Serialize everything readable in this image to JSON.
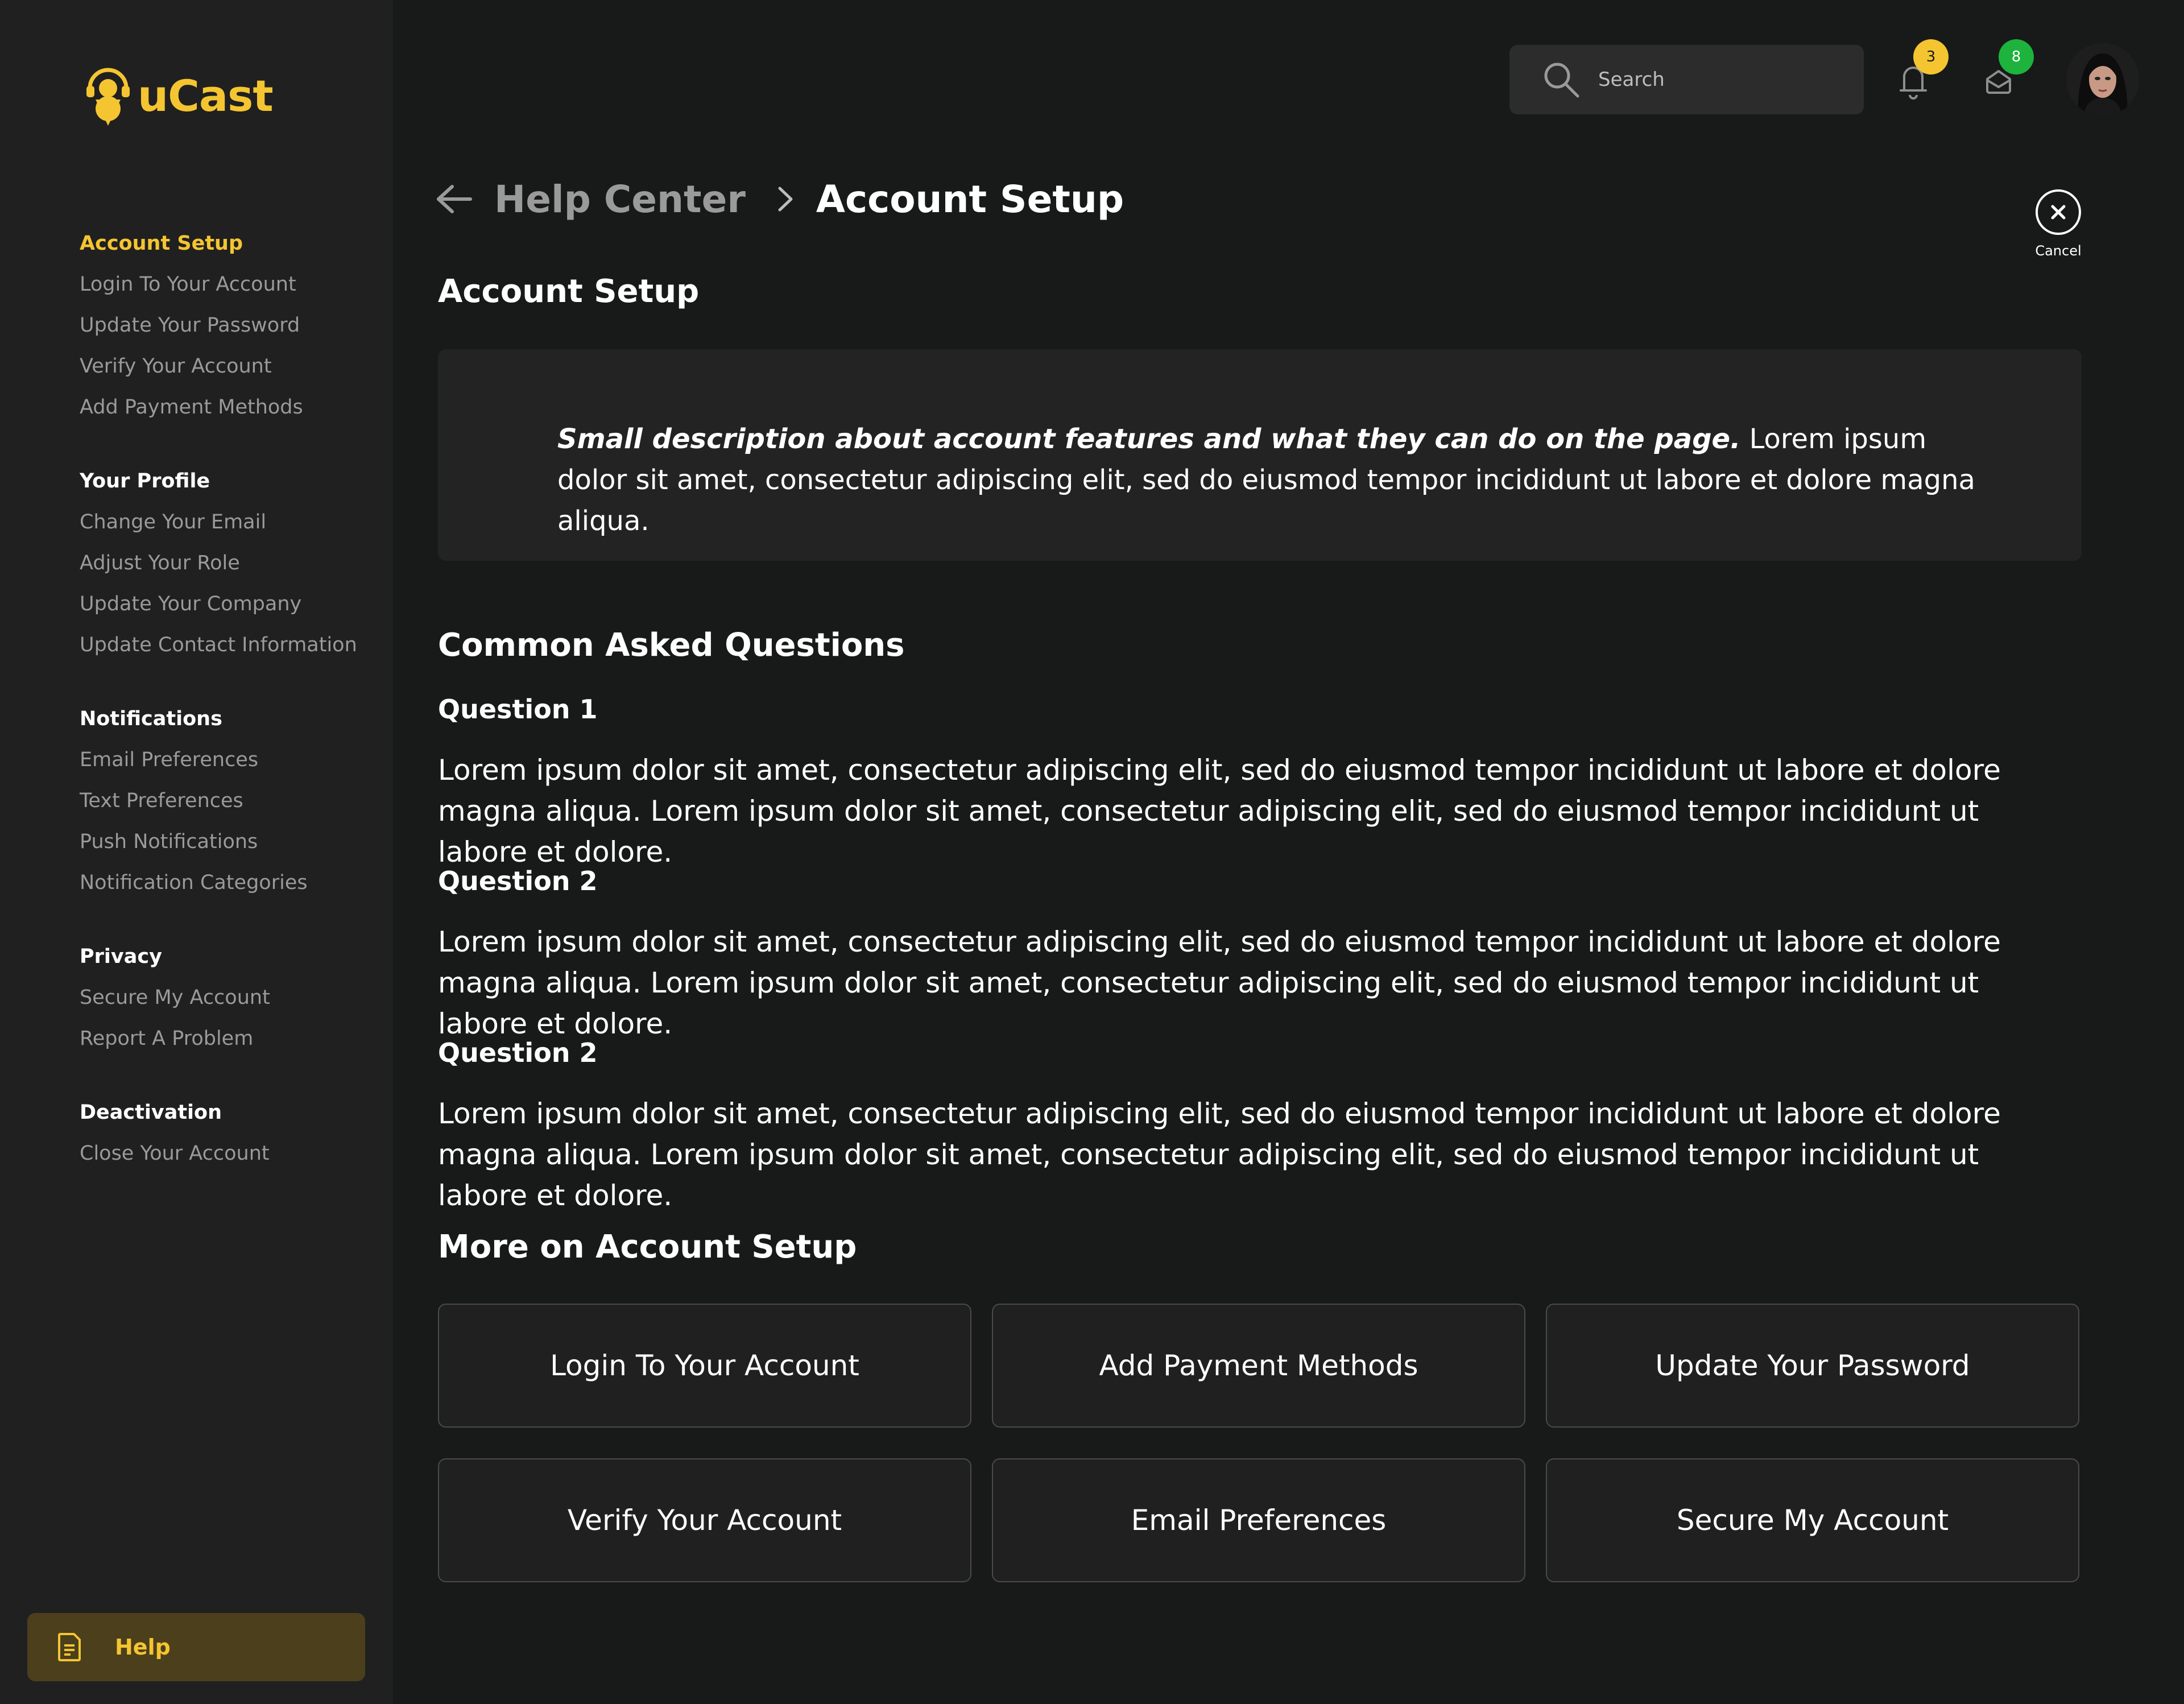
{
  "app": {
    "name": "uCast"
  },
  "sidebar": {
    "sections": [
      {
        "heading": "Account Setup",
        "active": true,
        "items": [
          "Login To Your Account",
          "Update Your Password",
          "Verify Your Account",
          "Add Payment Methods"
        ]
      },
      {
        "heading": "Your Profile",
        "active": false,
        "items": [
          "Change Your Email",
          "Adjust Your Role",
          "Update Your Company",
          "Update Contact Information"
        ]
      },
      {
        "heading": "Notifications",
        "active": false,
        "items": [
          "Email Preferences",
          "Text Preferences",
          "Push Notifications",
          "Notification Categories"
        ]
      },
      {
        "heading": "Privacy",
        "active": false,
        "items": [
          "Secure My Account",
          "Report A Problem"
        ]
      },
      {
        "heading": "Deactivation",
        "active": false,
        "items": [
          "Close Your Account"
        ]
      }
    ],
    "help_label": "Help"
  },
  "header": {
    "search_placeholder": "Search",
    "notifications_count": "3",
    "messages_count": "8"
  },
  "breadcrumb": {
    "parent": "Help Center",
    "current": "Account Setup"
  },
  "cancel_label": "Cancel",
  "main": {
    "title": "Account Setup",
    "description_bold": "Small description about account features and what they can do on the page.",
    "description_rest": " Lorem ipsum dolor sit amet, consectetur adipiscing elit, sed do eiusmod tempor incididunt ut labore et dolore magna aliqua.",
    "faq_title": "Common Asked Questions",
    "questions": [
      {
        "title": "Question 1",
        "answer": " Lorem ipsum dolor sit amet, consectetur adipiscing elit, sed do eiusmod tempor incididunt ut labore et dolore magna aliqua. Lorem ipsum dolor sit amet, consectetur adipiscing elit, sed do eiusmod tempor incididunt ut labore et dolore."
      },
      {
        "title": "Question  2",
        "answer": " Lorem ipsum dolor sit amet, consectetur adipiscing elit, sed do eiusmod tempor incididunt ut labore et dolore magna aliqua. Lorem ipsum dolor sit amet, consectetur adipiscing elit, sed do eiusmod tempor incididunt ut labore et dolore."
      },
      {
        "title": "Question  2",
        "answer": " Lorem ipsum dolor sit amet, consectetur adipiscing elit, sed do eiusmod tempor incididunt ut labore et dolore magna aliqua. Lorem ipsum dolor sit amet, consectetur adipiscing elit, sed do eiusmod tempor incididunt ut labore et dolore."
      }
    ],
    "more_title": "More on Account Setup",
    "more_links": [
      "Login To Your Account",
      "Add Payment Methods",
      "Update Your Password",
      "Verify Your Account",
      "Email Preferences",
      "Secure My Account"
    ]
  },
  "colors": {
    "accent": "#f4c531",
    "background": "#181919",
    "sidebar": "#202020",
    "help_button_bg": "#4b3f1c",
    "notification_badge": "#f4c531",
    "message_badge": "#1db33c"
  },
  "icons": {
    "logo": "podcast-mic-icon",
    "search": "search-icon",
    "notifications": "bell-icon",
    "messages": "mail-icon",
    "back": "arrow-left-icon",
    "separator": "chevron-right-icon",
    "cancel": "close-icon",
    "help": "document-icon"
  }
}
